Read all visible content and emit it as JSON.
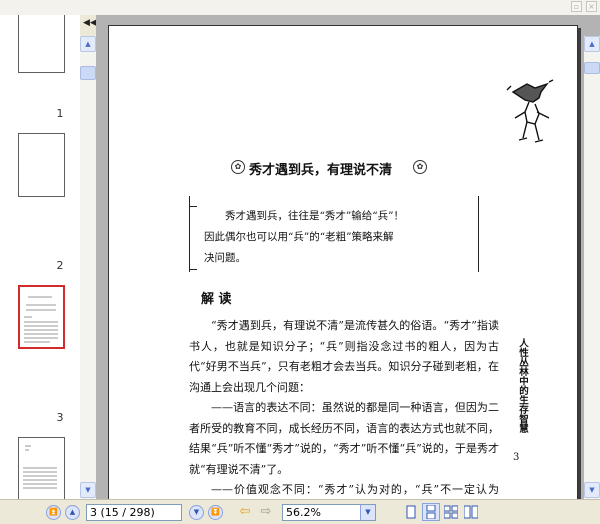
{
  "thumbnails": [
    {
      "label": "1"
    },
    {
      "label": "2"
    },
    {
      "label": "3"
    }
  ],
  "page": {
    "chapter_title": "秀才遇到兵，有理说不清",
    "quote_lines": [
      "秀才遇到兵，往往是“秀才”输给“兵”！",
      "因此偶尔也可以用“兵”的“老粗”策略来解",
      "决问题。"
    ],
    "section_heading": "解 读",
    "paragraphs": [
      "“秀才遇到兵，有理说不清”是流传甚久的俗语。“秀才”指读书人，也就是知识分子；“兵”则指没念过书的粗人，因为古代“好男不当兵”，只有老粗才会去当兵。知识分子碰到老粗，在沟通上会出现几个问题：",
      "——语言的表达不同：虽然说的都是同一种语言，但因为二者所受的教育不同，成长经历不同，语言的表达方式也就不同，结果“兵”听不懂“秀才”说的，“秀才”听不懂“兵”说的，于是秀才就“有理说不清”了。",
      "——价值观念不同：“秀才”认为对的，“兵”不一定认为对，“秀才”认为错的，“兵”不一定认为错，更有冲"
    ],
    "side_caption": "人性丛林中的生存智慧",
    "page_number": "3"
  },
  "statusbar": {
    "page_value": "3 (15 / 298)",
    "zoom_value": "56.2%"
  }
}
